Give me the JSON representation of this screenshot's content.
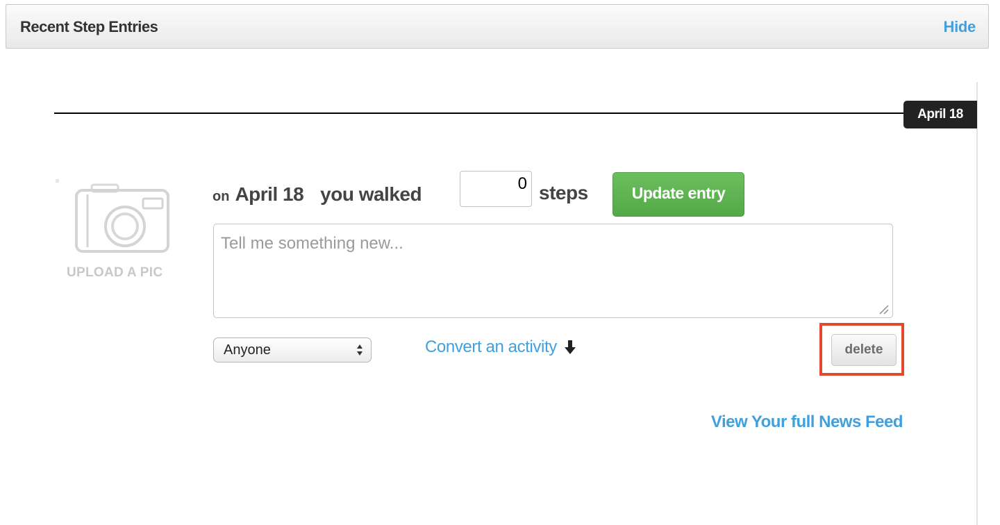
{
  "header": {
    "title": "Recent Step Entries",
    "hide_label": "Hide"
  },
  "timeline": {
    "date_label": "April 18"
  },
  "upload": {
    "label": "UPLOAD A PIC",
    "icon": "camera-icon"
  },
  "entry": {
    "on_label": "on",
    "date": "April 18",
    "walked_label": "you walked",
    "steps_value": "0",
    "steps_label": "steps",
    "update_label": "Update entry"
  },
  "message": {
    "placeholder": "Tell me something new..."
  },
  "privacy": {
    "selected": "Anyone"
  },
  "convert": {
    "label": "Convert an activity",
    "icon": "arrow-down-icon"
  },
  "delete": {
    "label": "delete",
    "highlight_color": "#e2492f"
  },
  "footer": {
    "news_feed_label": "View Your full News Feed"
  },
  "colors": {
    "link": "#41a0dc",
    "update_button": "#5cb04f",
    "date_pill": "#222222"
  }
}
